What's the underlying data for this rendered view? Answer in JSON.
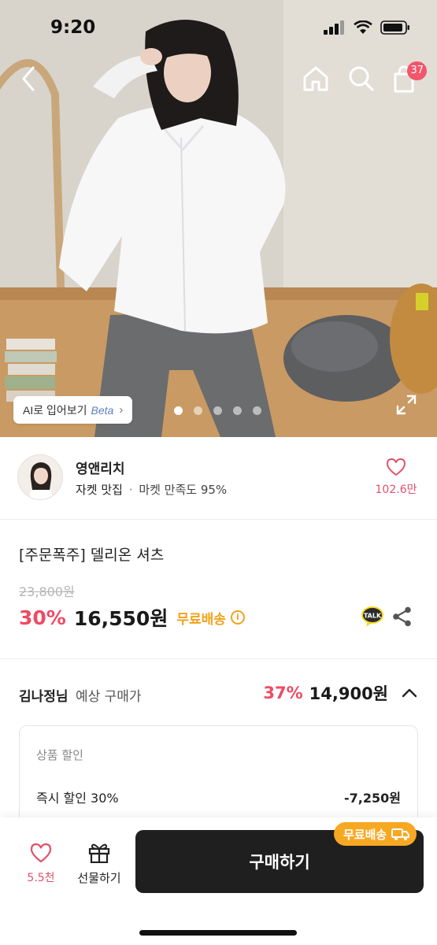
{
  "status_bar": {
    "time": "9:20"
  },
  "hero": {
    "cart_count": "37",
    "ai_try_label": "AI로 입어보기",
    "ai_try_beta": "Beta",
    "image_count": 5,
    "active_image_index": 1
  },
  "shop": {
    "name": "영앤리치",
    "tag": "자켓 맛집",
    "separator": "·",
    "satisfaction": "마켓 만족도 95%",
    "like_count": "102.6만"
  },
  "product": {
    "title": "[주문폭주] 델리온 셔츠",
    "original_price": "23,800원",
    "discount": "30%",
    "sale_price": "16,550원",
    "free_shipping": "무료배송"
  },
  "expected_price": {
    "user": "김나정님",
    "label": "예상 구매가",
    "discount": "37%",
    "price": "14,900원"
  },
  "discount_card": {
    "heading": "상품 할인",
    "items": [
      {
        "label": "즉시 할인 30%",
        "value": "-7,250원"
      }
    ]
  },
  "bottom_bar": {
    "like_count": "5.5천",
    "gift_label": "선물하기",
    "buy_label": "구매하기",
    "shipping_bubble": "무료배송"
  },
  "colors": {
    "accent_pink": "#f04a64",
    "shipping_orange": "#f1a21a",
    "buy_button": "#1f1f1f"
  },
  "icons": [
    "back-icon",
    "home-icon",
    "search-icon",
    "cart-icon",
    "expand-icon",
    "heart-icon",
    "info-icon",
    "kakao-talk-icon",
    "share-icon",
    "chevron-up-icon",
    "gift-icon",
    "truck-icon"
  ]
}
